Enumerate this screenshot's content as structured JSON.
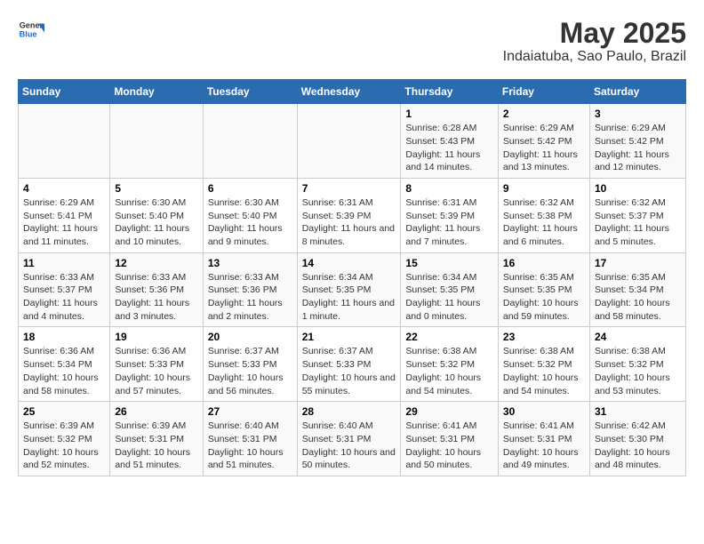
{
  "header": {
    "logo_general": "General",
    "logo_blue": "Blue",
    "title": "May 2025",
    "subtitle": "Indaiatuba, Sao Paulo, Brazil"
  },
  "days_of_week": [
    "Sunday",
    "Monday",
    "Tuesday",
    "Wednesday",
    "Thursday",
    "Friday",
    "Saturday"
  ],
  "weeks": [
    [
      {
        "day": "",
        "info": ""
      },
      {
        "day": "",
        "info": ""
      },
      {
        "day": "",
        "info": ""
      },
      {
        "day": "",
        "info": ""
      },
      {
        "day": "1",
        "info": "Sunrise: 6:28 AM\nSunset: 5:43 PM\nDaylight: 11 hours and 14 minutes."
      },
      {
        "day": "2",
        "info": "Sunrise: 6:29 AM\nSunset: 5:42 PM\nDaylight: 11 hours and 13 minutes."
      },
      {
        "day": "3",
        "info": "Sunrise: 6:29 AM\nSunset: 5:42 PM\nDaylight: 11 hours and 12 minutes."
      }
    ],
    [
      {
        "day": "4",
        "info": "Sunrise: 6:29 AM\nSunset: 5:41 PM\nDaylight: 11 hours and 11 minutes."
      },
      {
        "day": "5",
        "info": "Sunrise: 6:30 AM\nSunset: 5:40 PM\nDaylight: 11 hours and 10 minutes."
      },
      {
        "day": "6",
        "info": "Sunrise: 6:30 AM\nSunset: 5:40 PM\nDaylight: 11 hours and 9 minutes."
      },
      {
        "day": "7",
        "info": "Sunrise: 6:31 AM\nSunset: 5:39 PM\nDaylight: 11 hours and 8 minutes."
      },
      {
        "day": "8",
        "info": "Sunrise: 6:31 AM\nSunset: 5:39 PM\nDaylight: 11 hours and 7 minutes."
      },
      {
        "day": "9",
        "info": "Sunrise: 6:32 AM\nSunset: 5:38 PM\nDaylight: 11 hours and 6 minutes."
      },
      {
        "day": "10",
        "info": "Sunrise: 6:32 AM\nSunset: 5:37 PM\nDaylight: 11 hours and 5 minutes."
      }
    ],
    [
      {
        "day": "11",
        "info": "Sunrise: 6:33 AM\nSunset: 5:37 PM\nDaylight: 11 hours and 4 minutes."
      },
      {
        "day": "12",
        "info": "Sunrise: 6:33 AM\nSunset: 5:36 PM\nDaylight: 11 hours and 3 minutes."
      },
      {
        "day": "13",
        "info": "Sunrise: 6:33 AM\nSunset: 5:36 PM\nDaylight: 11 hours and 2 minutes."
      },
      {
        "day": "14",
        "info": "Sunrise: 6:34 AM\nSunset: 5:35 PM\nDaylight: 11 hours and 1 minute."
      },
      {
        "day": "15",
        "info": "Sunrise: 6:34 AM\nSunset: 5:35 PM\nDaylight: 11 hours and 0 minutes."
      },
      {
        "day": "16",
        "info": "Sunrise: 6:35 AM\nSunset: 5:35 PM\nDaylight: 10 hours and 59 minutes."
      },
      {
        "day": "17",
        "info": "Sunrise: 6:35 AM\nSunset: 5:34 PM\nDaylight: 10 hours and 58 minutes."
      }
    ],
    [
      {
        "day": "18",
        "info": "Sunrise: 6:36 AM\nSunset: 5:34 PM\nDaylight: 10 hours and 58 minutes."
      },
      {
        "day": "19",
        "info": "Sunrise: 6:36 AM\nSunset: 5:33 PM\nDaylight: 10 hours and 57 minutes."
      },
      {
        "day": "20",
        "info": "Sunrise: 6:37 AM\nSunset: 5:33 PM\nDaylight: 10 hours and 56 minutes."
      },
      {
        "day": "21",
        "info": "Sunrise: 6:37 AM\nSunset: 5:33 PM\nDaylight: 10 hours and 55 minutes."
      },
      {
        "day": "22",
        "info": "Sunrise: 6:38 AM\nSunset: 5:32 PM\nDaylight: 10 hours and 54 minutes."
      },
      {
        "day": "23",
        "info": "Sunrise: 6:38 AM\nSunset: 5:32 PM\nDaylight: 10 hours and 54 minutes."
      },
      {
        "day": "24",
        "info": "Sunrise: 6:38 AM\nSunset: 5:32 PM\nDaylight: 10 hours and 53 minutes."
      }
    ],
    [
      {
        "day": "25",
        "info": "Sunrise: 6:39 AM\nSunset: 5:32 PM\nDaylight: 10 hours and 52 minutes."
      },
      {
        "day": "26",
        "info": "Sunrise: 6:39 AM\nSunset: 5:31 PM\nDaylight: 10 hours and 51 minutes."
      },
      {
        "day": "27",
        "info": "Sunrise: 6:40 AM\nSunset: 5:31 PM\nDaylight: 10 hours and 51 minutes."
      },
      {
        "day": "28",
        "info": "Sunrise: 6:40 AM\nSunset: 5:31 PM\nDaylight: 10 hours and 50 minutes."
      },
      {
        "day": "29",
        "info": "Sunrise: 6:41 AM\nSunset: 5:31 PM\nDaylight: 10 hours and 50 minutes."
      },
      {
        "day": "30",
        "info": "Sunrise: 6:41 AM\nSunset: 5:31 PM\nDaylight: 10 hours and 49 minutes."
      },
      {
        "day": "31",
        "info": "Sunrise: 6:42 AM\nSunset: 5:30 PM\nDaylight: 10 hours and 48 minutes."
      }
    ]
  ]
}
